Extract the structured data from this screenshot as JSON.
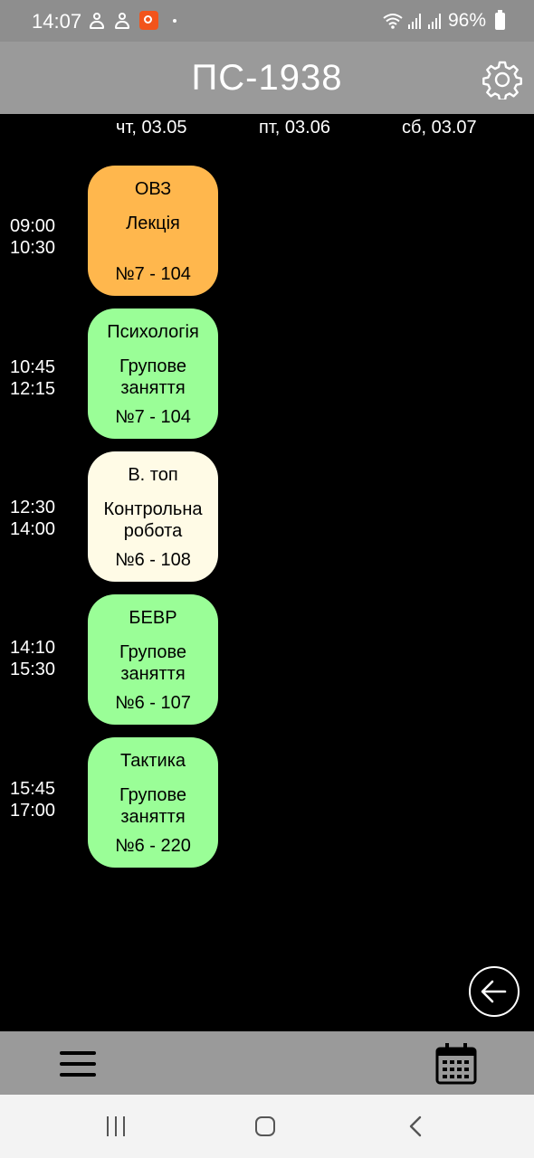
{
  "status_bar": {
    "time": "14:07",
    "battery": "96%",
    "icons": [
      "person-icon",
      "person-icon",
      "app-notification-icon",
      "dot-icon",
      "wifi-icon",
      "signal-icon",
      "signal-icon",
      "battery-icon"
    ]
  },
  "header": {
    "title": "ПС-1938",
    "settings_icon": "gear-icon"
  },
  "days": [
    "чт, 03.05",
    "пт, 03.06",
    "сб, 03.07"
  ],
  "lessons": [
    {
      "start": "09:00",
      "end": "10:30",
      "subject": "ОВЗ",
      "type": "Лекція",
      "room": "№7 - 104",
      "color": "#ffb74d"
    },
    {
      "start": "10:45",
      "end": "12:15",
      "subject": "Психологія",
      "type": "Групове заняття",
      "room": "№7 - 104",
      "color": "#9afe97"
    },
    {
      "start": "12:30",
      "end": "14:00",
      "subject": "В. топ",
      "type": "Контрольна робота",
      "room": "№6 - 108",
      "color": "#fffbe6"
    },
    {
      "start": "14:10",
      "end": "15:30",
      "subject": "БЕВР",
      "type": "Групове заняття",
      "room": "№6 - 107",
      "color": "#9afe97"
    },
    {
      "start": "15:45",
      "end": "17:00",
      "subject": "Тактика",
      "type": "Групове заняття",
      "room": "№6 - 220",
      "color": "#9afe97"
    }
  ],
  "toolbar": {
    "menu_icon": "hamburger-menu-icon",
    "calendar_icon": "calendar-icon",
    "back_icon": "arrow-left-icon"
  },
  "system_nav": {
    "recent_icon": "recent-apps-icon",
    "home_icon": "home-icon",
    "back_icon": "back-icon"
  }
}
